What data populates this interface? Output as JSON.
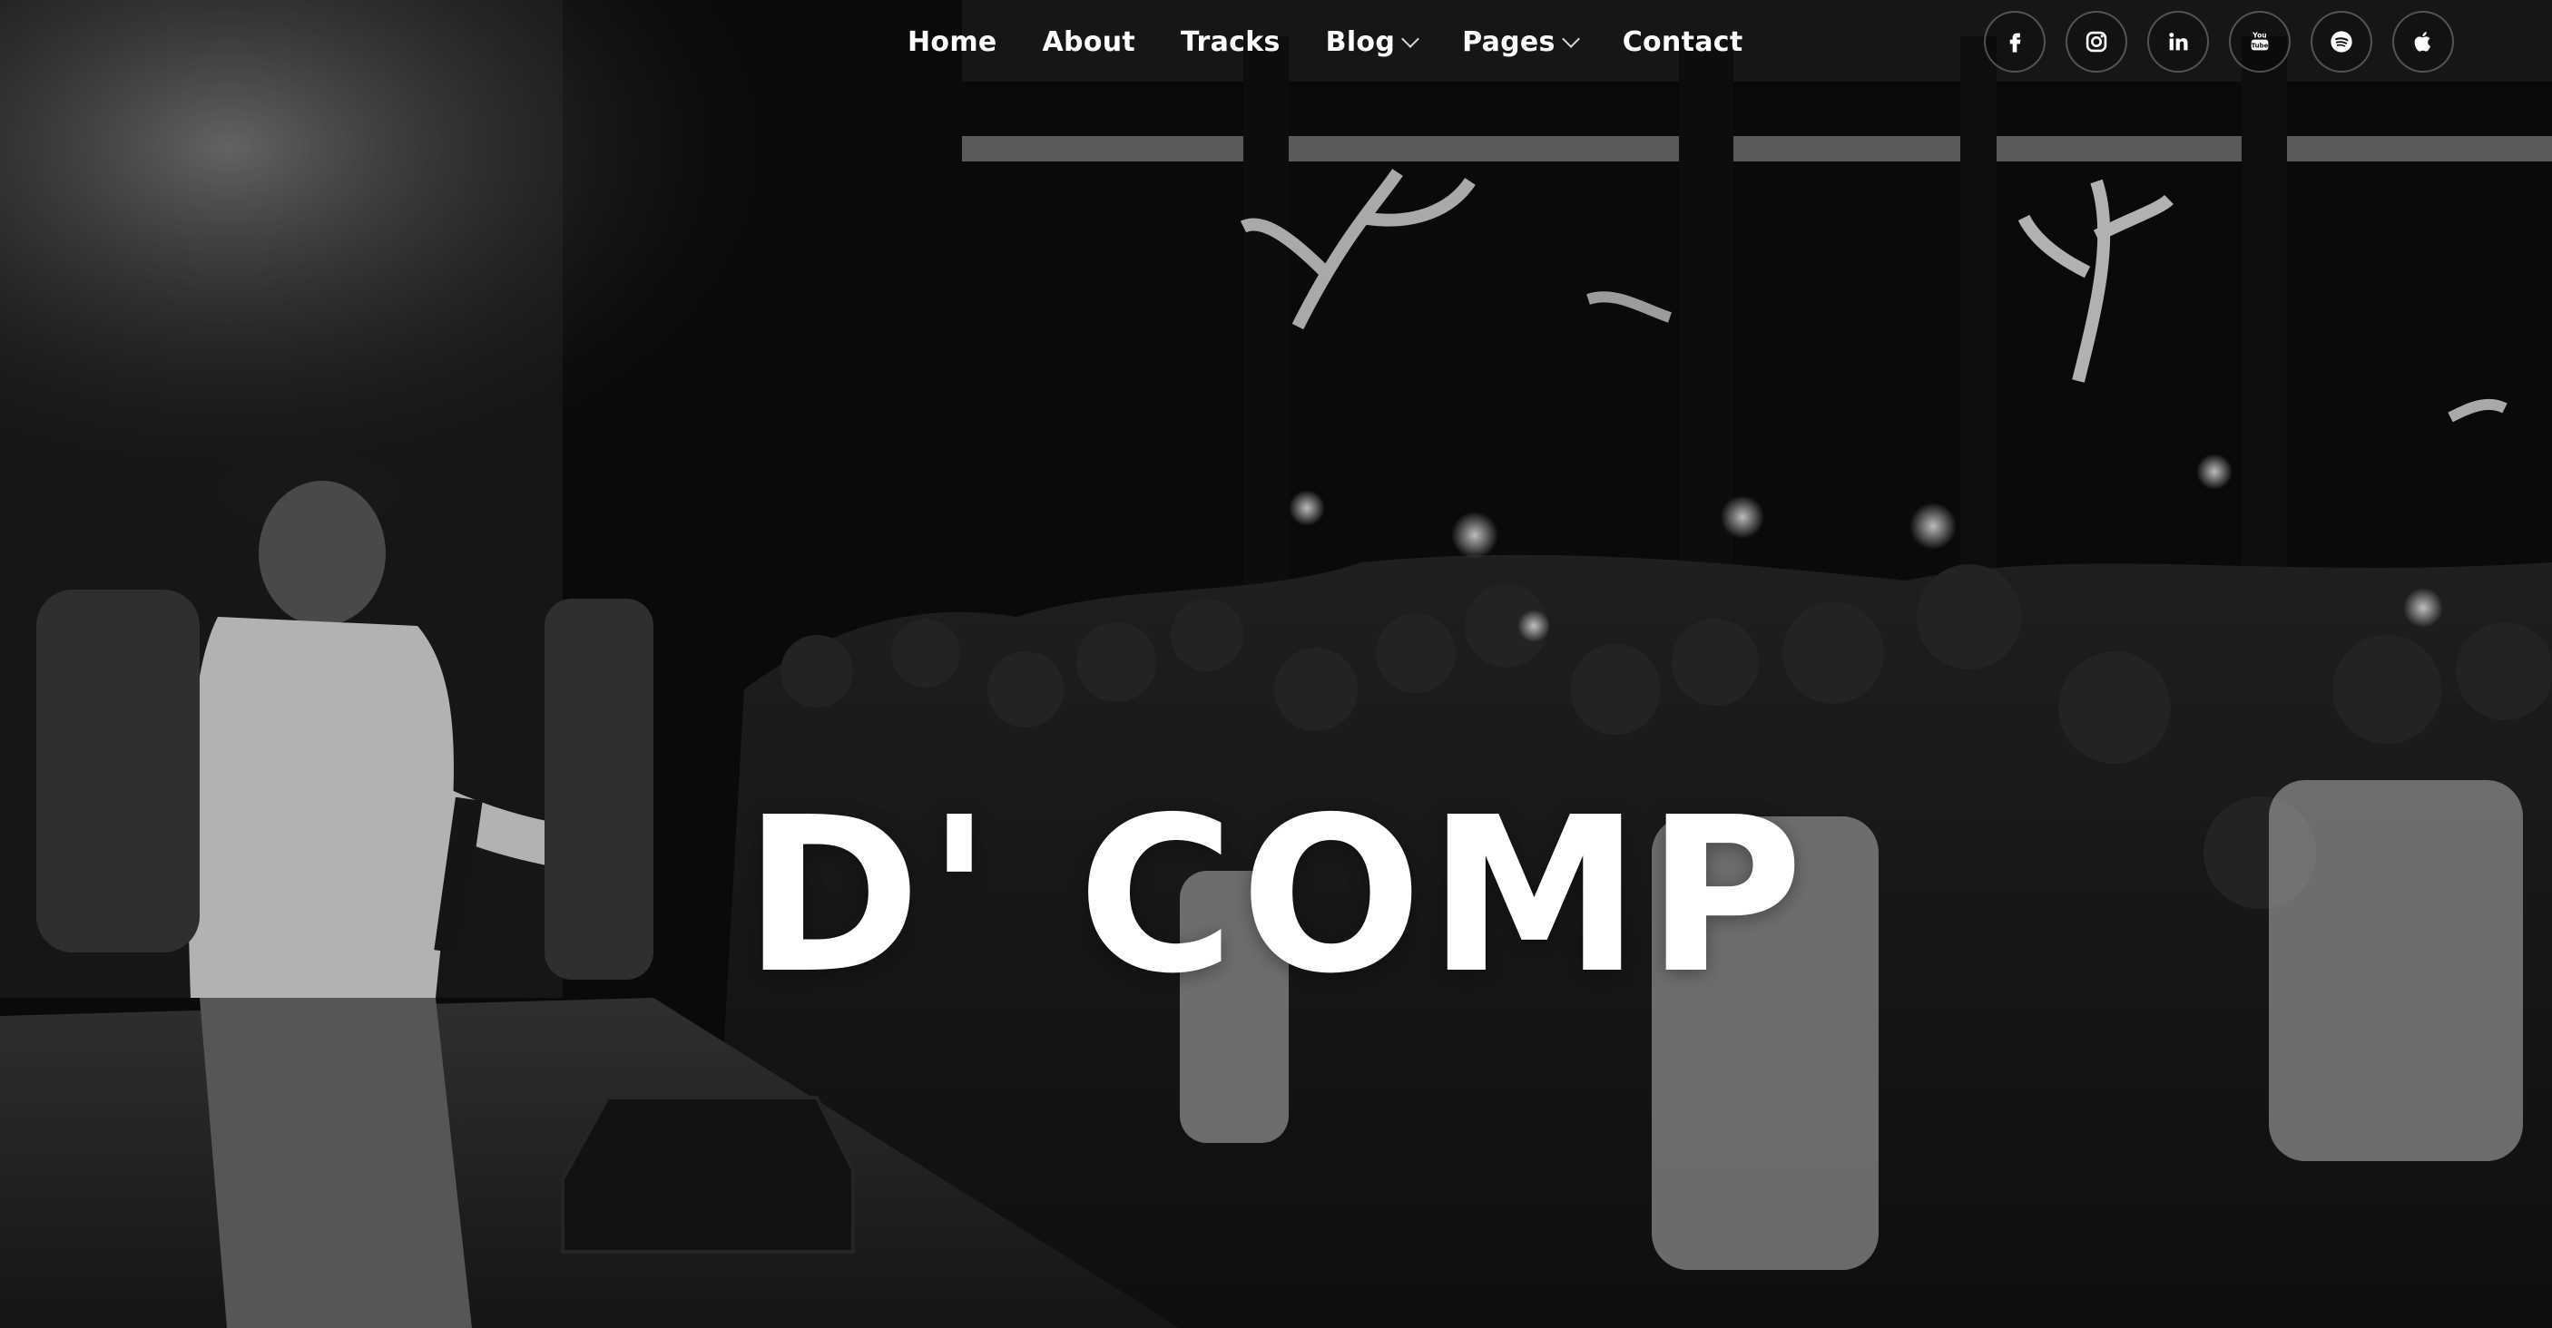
{
  "nav": {
    "items": [
      {
        "label": "Home",
        "has_dropdown": false
      },
      {
        "label": "About",
        "has_dropdown": false
      },
      {
        "label": "Tracks",
        "has_dropdown": false
      },
      {
        "label": "Blog",
        "has_dropdown": true
      },
      {
        "label": "Pages",
        "has_dropdown": true
      },
      {
        "label": "Contact",
        "has_dropdown": false
      }
    ]
  },
  "social": {
    "icons": [
      "facebook-icon",
      "instagram-icon",
      "linkedin-icon",
      "youtube-icon",
      "spotify-icon",
      "apple-icon"
    ]
  },
  "hero": {
    "title": "D' COMP",
    "background": "black-and-white photo of a performer on stage facing a crowd holding up phones"
  },
  "colors": {
    "text": "#ffffff",
    "icon_border": "rgba(255,255,255,0.28)",
    "background": "#0b0b0b"
  }
}
